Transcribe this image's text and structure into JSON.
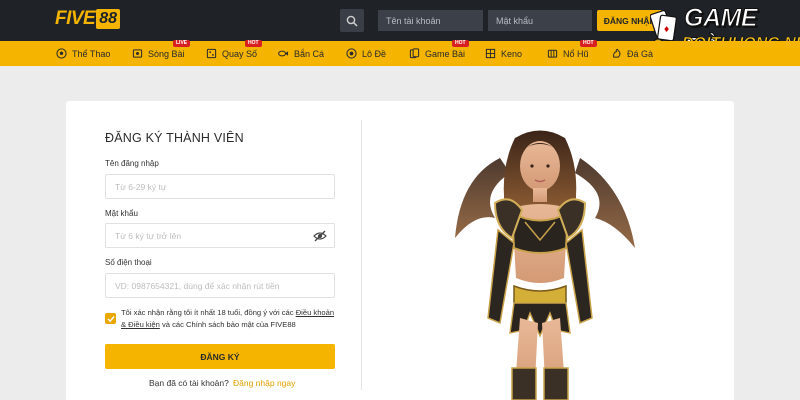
{
  "header": {
    "logo_text": "FIVE",
    "logo_num": "88",
    "username_placeholder": "Tên tài khoản",
    "password_placeholder": "Mật khẩu",
    "login_label": "ĐĂNG NHẬP"
  },
  "brand": {
    "line1": "GAME BÀI",
    "line2": "DOITHUONG.NET"
  },
  "nav": {
    "items": [
      {
        "label": "Thể Thao",
        "icon": "soccer-ball-icon",
        "badge": ""
      },
      {
        "label": "Sòng Bài",
        "icon": "casino-icon",
        "badge": "LIVE"
      },
      {
        "label": "Quay Số",
        "icon": "lottery-icon",
        "badge": "HOT"
      },
      {
        "label": "Bắn Cá",
        "icon": "fish-icon",
        "badge": ""
      },
      {
        "label": "Lô Đề",
        "icon": "lotto-icon",
        "badge": ""
      },
      {
        "label": "Game Bài",
        "icon": "cards-icon",
        "badge": "HOT"
      },
      {
        "label": "Keno",
        "icon": "keno-icon",
        "badge": ""
      },
      {
        "label": "Nổ Hũ",
        "icon": "jackpot-icon",
        "badge": "HOT"
      },
      {
        "label": "Đá Gà",
        "icon": "rooster-icon",
        "badge": ""
      }
    ]
  },
  "form": {
    "title": "ĐĂNG KÝ THÀNH VIÊN",
    "username_label": "Tên đăng nhập",
    "username_placeholder": "Từ 6-29 ký tự",
    "password_label": "Mật khẩu",
    "password_placeholder": "Từ 6 ký tự trở lên",
    "phone_label": "Số điện thoại",
    "phone_placeholder": "VD: 0987654321, dùng để xác nhận rút tiền",
    "terms_prefix": "Tôi xác nhận rằng tôi ít nhất 18 tuổi, đồng ý với các ",
    "terms_link1": "Điều khoản",
    "terms_link2": "& Điều kiện",
    "terms_suffix": " và các Chính sách bảo mật của FIVE88",
    "terms_checked": true,
    "register_label": "ĐĂNG KÝ",
    "have_account": "Bạn đã có tài khoản?",
    "login_now": "Đăng nhập ngay"
  },
  "colors": {
    "accent": "#f4b400",
    "topbar": "#1f2328",
    "link": "#e0a000"
  }
}
